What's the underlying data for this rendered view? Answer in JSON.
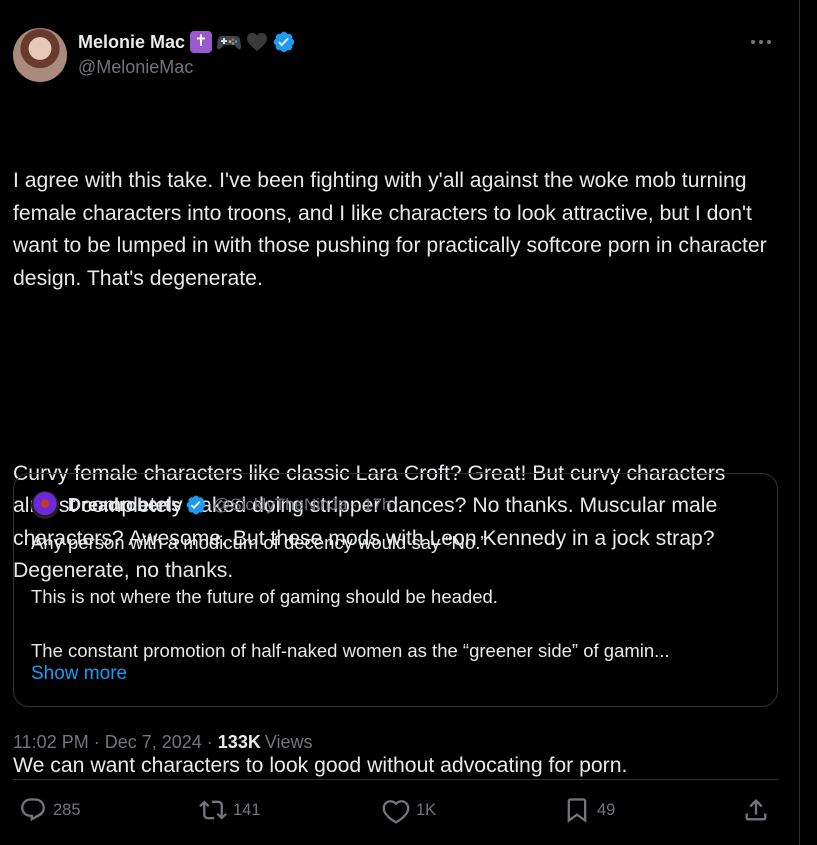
{
  "author": {
    "name": "Melonie Mac",
    "handle": "@MelonieMac",
    "emoji_cross": "✝",
    "verified_color": "#1d9bf0"
  },
  "tweet": {
    "paragraphs": [
      "I agree with this take. I've been fighting with y'all against the woke mob turning female characters into troons, and I like characters to look attractive, but I don't want to be lumped in with those pushing for practically softcore porn in character design. That's degenerate.",
      "Curvy female characters like classic Lara Croft? Great! But curvy characters almost completely naked doing stripper dances? No thanks. Muscular male characters? Awesome. But these mods with Leon Kennedy in a jock strap? Degenerate, no thanks.",
      "We can want characters to look good without advocating for porn."
    ]
  },
  "quote": {
    "name": "Dreadroberts",
    "handle": "@SicklyTheNinJa",
    "separator": "·",
    "age": "17h",
    "lines": [
      "Any person with a modicum of decency would say “No.”",
      "This is not where the future of gaming should be headed.",
      "The constant promotion of half-naked women as the “greener side” of gamin..."
    ],
    "show_more": "Show more"
  },
  "meta": {
    "time": "11:02 PM",
    "dot": "·",
    "date": "Dec 7, 2024",
    "views_count": "133K",
    "views_label": "Views"
  },
  "actions": {
    "replies": "285",
    "reposts": "141",
    "likes": "1K",
    "bookmarks": "49"
  },
  "icons": {
    "more": "more-horizontal-icon",
    "reply": "reply-icon",
    "repost": "repost-icon",
    "like": "heart-icon",
    "bookmark": "bookmark-icon",
    "share": "share-icon"
  },
  "colors": {
    "background": "#000000",
    "text": "#e7e9ea",
    "muted": "#71767b",
    "accent": "#1d9bf0",
    "border": "#2f3336"
  }
}
